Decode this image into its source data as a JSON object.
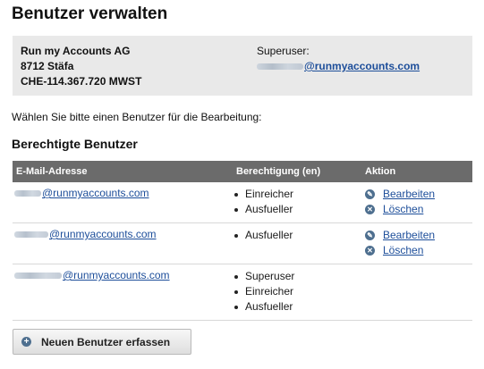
{
  "page": {
    "title": "Benutzer verwalten"
  },
  "company": {
    "name": "Run my Accounts AG",
    "address": "8712 Stäfa",
    "vat": "CHE-114.367.720 MWST",
    "superuser_label": "Superuser:",
    "superuser_email_domain": "@runmyaccounts.com"
  },
  "instruction": "Wählen Sie bitte einen Benutzer für die Bearbeitung:",
  "section_title": "Berechtigte Benutzer",
  "table": {
    "headers": {
      "email": "E-Mail-Adresse",
      "permission": "Berechtigung (en)",
      "action": "Aktion"
    },
    "rows": [
      {
        "email_domain": "@runmyaccounts.com",
        "permissions": [
          "Einreicher",
          "Ausfueller"
        ],
        "actions": [
          "Bearbeiten",
          "Löschen"
        ]
      },
      {
        "email_domain": "@runmyaccounts.com",
        "permissions": [
          "Ausfueller"
        ],
        "actions": [
          "Bearbeiten",
          "Löschen"
        ]
      },
      {
        "email_domain": "@runmyaccounts.com",
        "permissions": [
          "Superuser",
          "Einreicher",
          "Ausfueller"
        ],
        "actions": []
      }
    ]
  },
  "add_button": {
    "label": "Neuen Benutzer erfassen",
    "icon": "plus-circle-icon"
  },
  "icons": {
    "edit": "pencil-circle-icon",
    "delete": "x-circle-icon"
  },
  "colors": {
    "link": "#1d4e9a",
    "table_header": "#6b6b6b",
    "company_box": "#e9e9e9",
    "icon": "#4e6f8f"
  }
}
